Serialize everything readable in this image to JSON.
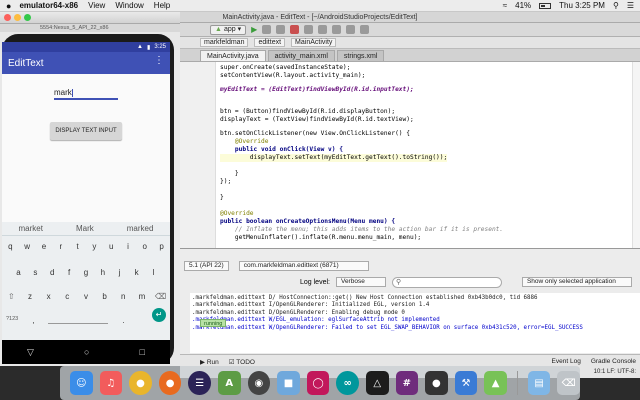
{
  "menubar": {
    "apple": "",
    "app_name": "emulator64-x86",
    "items": [
      "View",
      "Window",
      "Help"
    ],
    "battery": "41%",
    "clock": "Thu 3:25 PM"
  },
  "ide": {
    "title": "MainActivity.java - EditText - [~/AndroidStudioProjects/EditText]",
    "toolbar_app": "app",
    "breadcrumbs": [
      "markfeldman",
      "edittext",
      "MainActivity"
    ],
    "tabs": [
      "MainActivity.java",
      "activity_main.xml",
      "strings.xml"
    ],
    "code_lines": [
      "super.onCreate(savedInstanceState);",
      "setContentView(R.layout.activity_main);",
      "",
      "myEditText = (EditText)findViewById(R.id.inputText);",
      "",
      "",
      "btn = (Button)findViewById(R.id.displayButton);",
      "displayText = (TextView)findViewById(R.id.textView);",
      "",
      "btn.setOnClickListener(new View.OnClickListener() {",
      "    @Override",
      "    public void onClick(View v) {",
      "        displayText.setText(myEditText.getText().toString());",
      "",
      "    }",
      "});",
      "",
      "}",
      "",
      "@Override",
      "public boolean onCreateOptionsMenu(Menu menu) {",
      "    // Inflate the menu; this adds items to the action bar if it is present.",
      "    getMenuInflater().inflate(R.menu.menu_main, menu);"
    ]
  },
  "monitor": {
    "device": "5.1 (API 22)",
    "process": "com.markfeldman.edittext (6871)",
    "log_level_label": "Log level:",
    "log_level": "Verbose",
    "search_placeholder": "",
    "filter": "Show only selected application",
    "log_lines": [
      ".markfeldman.edittext D/   HostConnection::get() New Host Connection established 0xb43b0dc0, tid 6886",
      ".markfeldman.edittext I/OpenGLRenderer:  Initialized EGL, version 1.4",
      ".markfeldman.edittext D/OpenGLRenderer:  Enabling debug mode 0",
      ".markfeldman.edittext W/EGL_emulation:  eglSurfaceAttrib not implemented",
      ".markfeldman.edittext W/OpenGLRenderer:  Failed to set EGL_SWAP_BEHAVIOR on surface 0xb431c520, error=EGL_SUCCESS"
    ],
    "running": "running"
  },
  "statusbar": {
    "run": "Run",
    "todo": "TODO",
    "event_log": "Event Log",
    "gradle_console": "Gradle Console",
    "position": "10:1",
    "line_sep": "LF:",
    "encoding": "UTF-8:"
  },
  "emulator": {
    "window_title": "5554:Nexus_5_API_22_x86",
    "time": "3:25",
    "app_title": "EditText",
    "input_value": "mark",
    "button_label": "DISPLAY TEXT INPUT",
    "suggestions": [
      "market",
      "Mark",
      "marked"
    ],
    "keyboard_rows": [
      [
        "q",
        "w",
        "e",
        "r",
        "t",
        "y",
        "u",
        "i",
        "o",
        "p"
      ],
      [
        "a",
        "s",
        "d",
        "f",
        "g",
        "h",
        "j",
        "k",
        "l"
      ],
      [
        "z",
        "x",
        "c",
        "v",
        "b",
        "n",
        "m"
      ]
    ],
    "sym_key": "?123",
    "comma": ",",
    "period": "."
  },
  "dock": {
    "icons": [
      "finder-icon",
      "music-icon",
      "chrome-icon",
      "firefox-icon",
      "eclipse-icon",
      "android-studio-icon",
      "speaker-icon",
      "virtualbox-icon",
      "flickr-icon",
      "arduino-icon",
      "processing-icon",
      "slack-icon",
      "github-icon",
      "xcode-icon",
      "android-icon",
      "folder-icon",
      "trash-icon"
    ]
  },
  "colors": {
    "appbar": "#3f51b5",
    "statusbar": "#303f9f",
    "accent_fab": "#009688"
  }
}
